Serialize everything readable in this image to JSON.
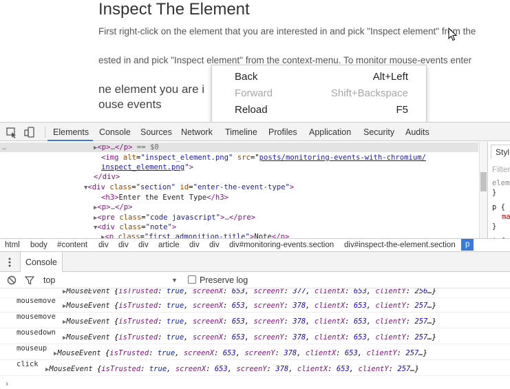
{
  "page": {
    "heading": "Inspect The Element",
    "paragraph1": "First right-click on the element that you are interested in and pick \"Inspect element\" from the",
    "paragraph2": "ested in and pick \"Inspect element\" from the context-menu. To monitor mouse-events enter",
    "paragraph3": "ne element you are i",
    "paragraph4": "ouse events"
  },
  "context_menu": {
    "items": [
      {
        "label": "Back",
        "shortcut": "Alt+Left",
        "enabled": true
      },
      {
        "label": "Forward",
        "shortcut": "Shift+Backspace",
        "enabled": false
      },
      {
        "label": "Reload",
        "shortcut": "F5",
        "enabled": true
      }
    ]
  },
  "devtools": {
    "tabs": [
      "Elements",
      "Console",
      "Sources",
      "Network",
      "Timeline",
      "Profiles",
      "Application",
      "Security",
      "Audits"
    ],
    "active_tab": "Elements",
    "elements": {
      "selected_marker": "== $0",
      "img_alt_attr": "alt",
      "img_alt": "\"inspect_element.png\"",
      "img_src_attr": "src",
      "img_src1": "posts/monitoring-events-with-chromium/",
      "img_src2": "inspect_element.png",
      "section_class": "\"section\"",
      "section_id": "\"enter-the-event-type\"",
      "h3_text": "Enter the Event Type",
      "pre_class": "\"code javascript\"",
      "note_class": "\"note\"",
      "p_class_partial": "\"first admonition-title\"",
      "p_text_partial": "Note"
    },
    "styles": {
      "tab_label": "Styl",
      "filter_placeholder": "Filter",
      "lines": [
        "elem",
        "}",
        "p {",
        "ma",
        "}",
        "* {"
      ]
    },
    "breadcrumb": [
      "html",
      "body",
      "#content",
      "div",
      "div",
      "div",
      "article",
      "div",
      "div",
      "div#monitoring-events.section",
      "div#inspect-the-element.section",
      "p"
    ],
    "drawer": {
      "tab_label": "Console",
      "context": "top",
      "preserve_log_label": "Preserve log"
    },
    "console_rows": [
      {
        "type": "",
        "obj": "MouseEvent",
        "trusted": "true",
        "screenX": "653",
        "screenY": "377",
        "clientX": "653",
        "clientY": "256"
      },
      {
        "type": "mousemove",
        "obj": "MouseEvent",
        "trusted": "true",
        "screenX": "653",
        "screenY": "378",
        "clientX": "653",
        "clientY": "257"
      },
      {
        "type": "mousemove",
        "obj": "MouseEvent",
        "trusted": "true",
        "screenX": "653",
        "screenY": "378",
        "clientX": "653",
        "clientY": "257"
      },
      {
        "type": "mousedown",
        "obj": "MouseEvent",
        "trusted": "true",
        "screenX": "653",
        "screenY": "378",
        "clientX": "653",
        "clientY": "257"
      },
      {
        "type": "mouseup",
        "obj": "MouseEvent",
        "trusted": "true",
        "screenX": "653",
        "screenY": "378",
        "clientX": "653",
        "clientY": "257"
      },
      {
        "type": "click",
        "obj": "MouseEvent",
        "trusted": "true",
        "screenX": "653",
        "screenY": "378",
        "clientX": "653",
        "clientY": "257"
      }
    ]
  },
  "colors": {
    "accent": "#3879d9",
    "tag": "#881280",
    "attr_name": "#994500",
    "attr_value": "#1a1aa6"
  },
  "icons": [
    "cursor-arrow-icon",
    "inspect-element-icon",
    "device-mode-icon",
    "drawer-menu-icon",
    "clear-console-icon",
    "filter-icon",
    "dropdown-caret-icon",
    "expand-triangle-icon",
    "console-prompt-icon"
  ]
}
